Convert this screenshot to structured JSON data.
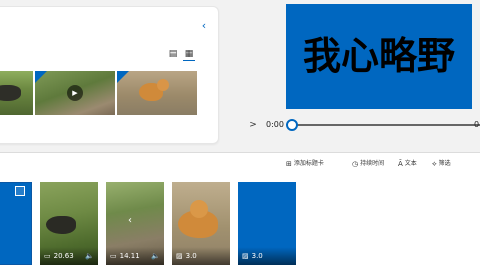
{
  "library": {
    "collapse_icon": "‹",
    "view_detail_icon": "▤",
    "view_grid_icon": "▦",
    "play_icon": "▶"
  },
  "preview": {
    "title_text": "我心略野"
  },
  "playback": {
    "play_icon": ">",
    "current_time": "0:00",
    "end_time": "0",
    "progress_fraction": 0
  },
  "storyboard": {
    "toolbar": {
      "title_icon": "⊞",
      "title_label": "添加标题卡",
      "duration_icon": "◷",
      "duration_label": "持续时间",
      "text_icon": "Ā",
      "text_label": "文本",
      "filter_icon": "⟡",
      "filter_label": "筛选"
    },
    "cards": [
      {
        "duration": "",
        "type_icon": ""
      },
      {
        "duration": "20.63",
        "type_icon": "▭",
        "volume_icon": "🔈"
      },
      {
        "duration": "14.11",
        "type_icon": "▭",
        "volume_icon": "🔈",
        "nav_icon": "‹"
      },
      {
        "duration": "3.0",
        "type_icon": "▨"
      },
      {
        "duration": "3.0",
        "type_icon": "▨"
      }
    ]
  },
  "colors": {
    "accent": "#0067c0",
    "preview_text": "#000000"
  }
}
